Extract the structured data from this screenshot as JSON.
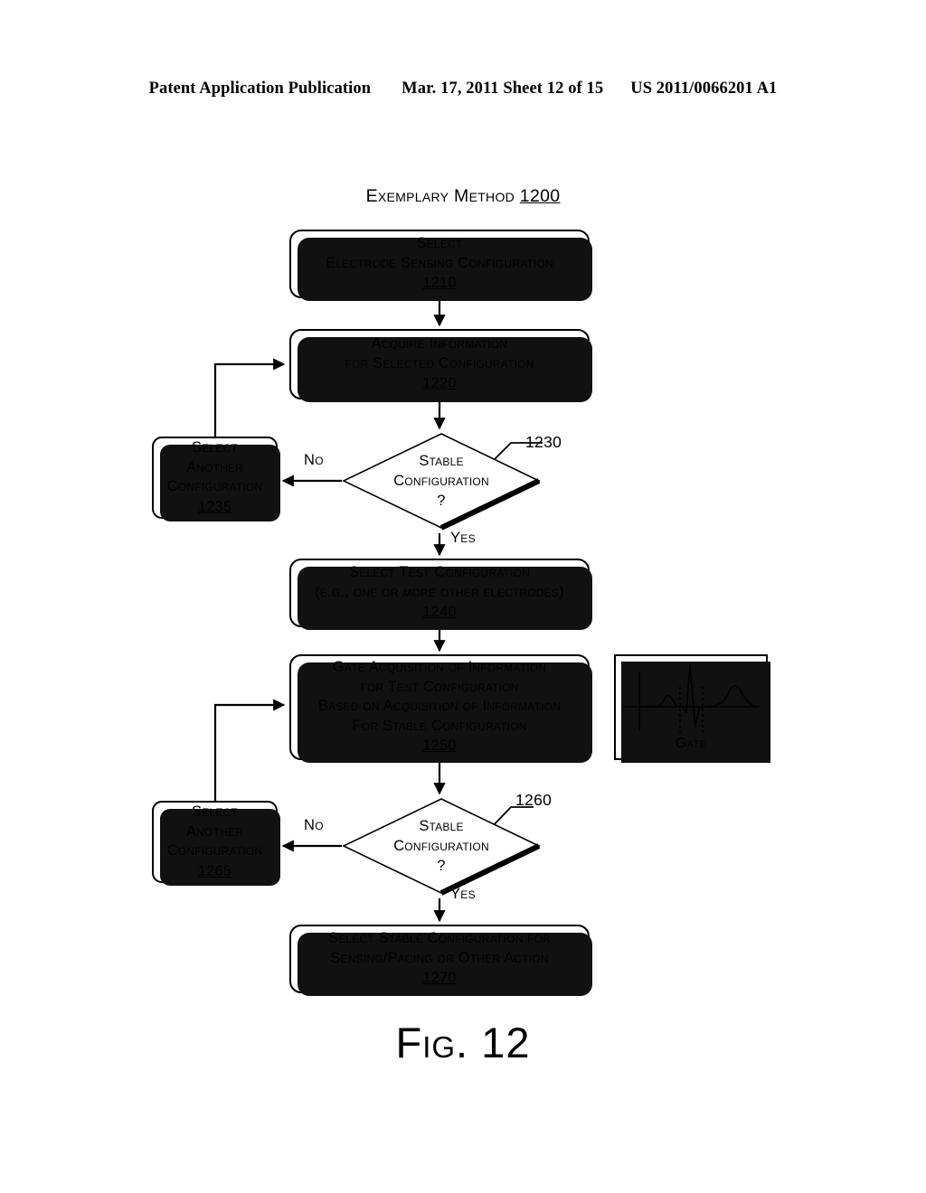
{
  "header": {
    "publication": "Patent Application Publication",
    "date_sheet": "Mar. 17, 2011  Sheet 12 of 15",
    "doc_number": "US 2011/0066201 A1"
  },
  "figure": {
    "title_text": "Exemplary Method",
    "title_number": "1200",
    "caption": "Fig. 12"
  },
  "nodes": {
    "n1210": {
      "line1": "Select",
      "line2": "Electrode Sensing Configuration",
      "number": "1210"
    },
    "n1220": {
      "line1": "Acquire Information",
      "line2": "for Selected Configuration",
      "number": "1220"
    },
    "n1230": {
      "line1": "Stable",
      "line2": "Configuration",
      "line3": "?",
      "number": "1230"
    },
    "n1235": {
      "line1": "Select",
      "line2": "Another",
      "line3": "Configuration",
      "number": "1235"
    },
    "n1240": {
      "line1": "Select Test Configuration",
      "line2": "(e.g., one or more other electrodes)",
      "number": "1240"
    },
    "n1250": {
      "line1": "Gate Acquisition of Information",
      "line2": "for Test Configuration",
      "line3": "Based on Acquisition of Information",
      "line4": "For Stable Configuration",
      "number": "1250"
    },
    "n1260": {
      "line1": "Stable",
      "line2": "Configuration",
      "line3": "?",
      "number": "1260"
    },
    "n1265": {
      "line1": "Select",
      "line2": "Another",
      "line3": "Configuration",
      "number": "1265"
    },
    "n1270": {
      "line1": "Select Stable Configuration for",
      "line2": "Sensing/Pacing or Other Action",
      "number": "1270"
    }
  },
  "branch_labels": {
    "no_1": "No",
    "yes_1": "Yes",
    "no_2": "No",
    "yes_2": "Yes"
  },
  "gate_panel": {
    "caption": "Gate"
  },
  "colors": {
    "ink": "#000000",
    "paper": "#ffffff"
  }
}
